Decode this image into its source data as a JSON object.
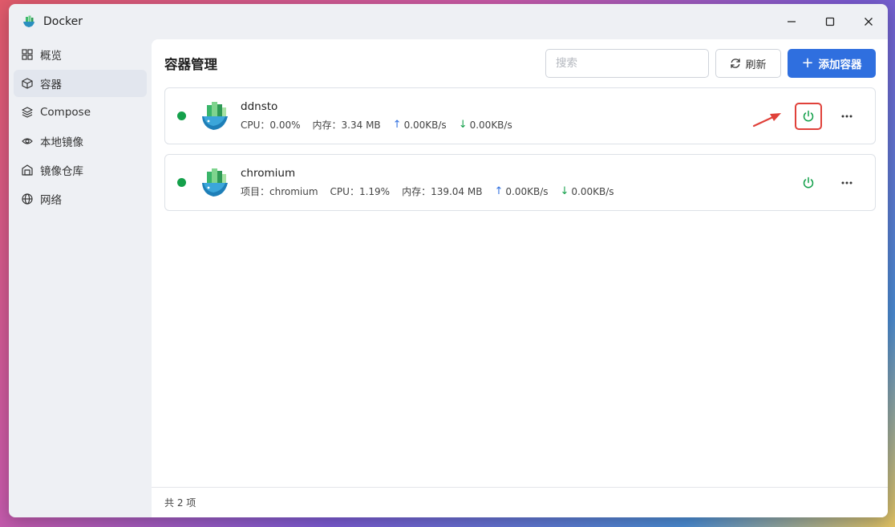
{
  "window": {
    "title": "Docker"
  },
  "sidebar": {
    "items": [
      {
        "label": "概览",
        "icon": "grid-icon",
        "active": false
      },
      {
        "label": "容器",
        "icon": "cube-icon",
        "active": true
      },
      {
        "label": "Compose",
        "icon": "layers-icon",
        "active": false
      },
      {
        "label": "本地镜像",
        "icon": "eye-icon",
        "active": false
      },
      {
        "label": "镜像仓库",
        "icon": "warehouse-icon",
        "active": false
      },
      {
        "label": "网络",
        "icon": "globe-icon",
        "active": false
      }
    ]
  },
  "header": {
    "title": "容器管理",
    "search_placeholder": "搜索",
    "refresh_label": "刷新",
    "add_label": "添加容器"
  },
  "containers": [
    {
      "name": "ddnsto",
      "status": "running",
      "cpu": "CPU：0.00%",
      "mem": "内存：3.34 MB",
      "up": "0.00KB/s",
      "down": "0.00KB/s",
      "highlighted": true
    },
    {
      "name": "chromium",
      "status": "running",
      "project": "项目：chromium",
      "cpu": "CPU：1.19%",
      "mem": "内存：139.04 MB",
      "up": "0.00KB/s",
      "down": "0.00KB/s",
      "highlighted": false
    }
  ],
  "footer": {
    "count_text": "共 2 项"
  },
  "colors": {
    "accent": "#2f6fdf",
    "running": "#14a04b",
    "highlight": "#e0413a"
  }
}
